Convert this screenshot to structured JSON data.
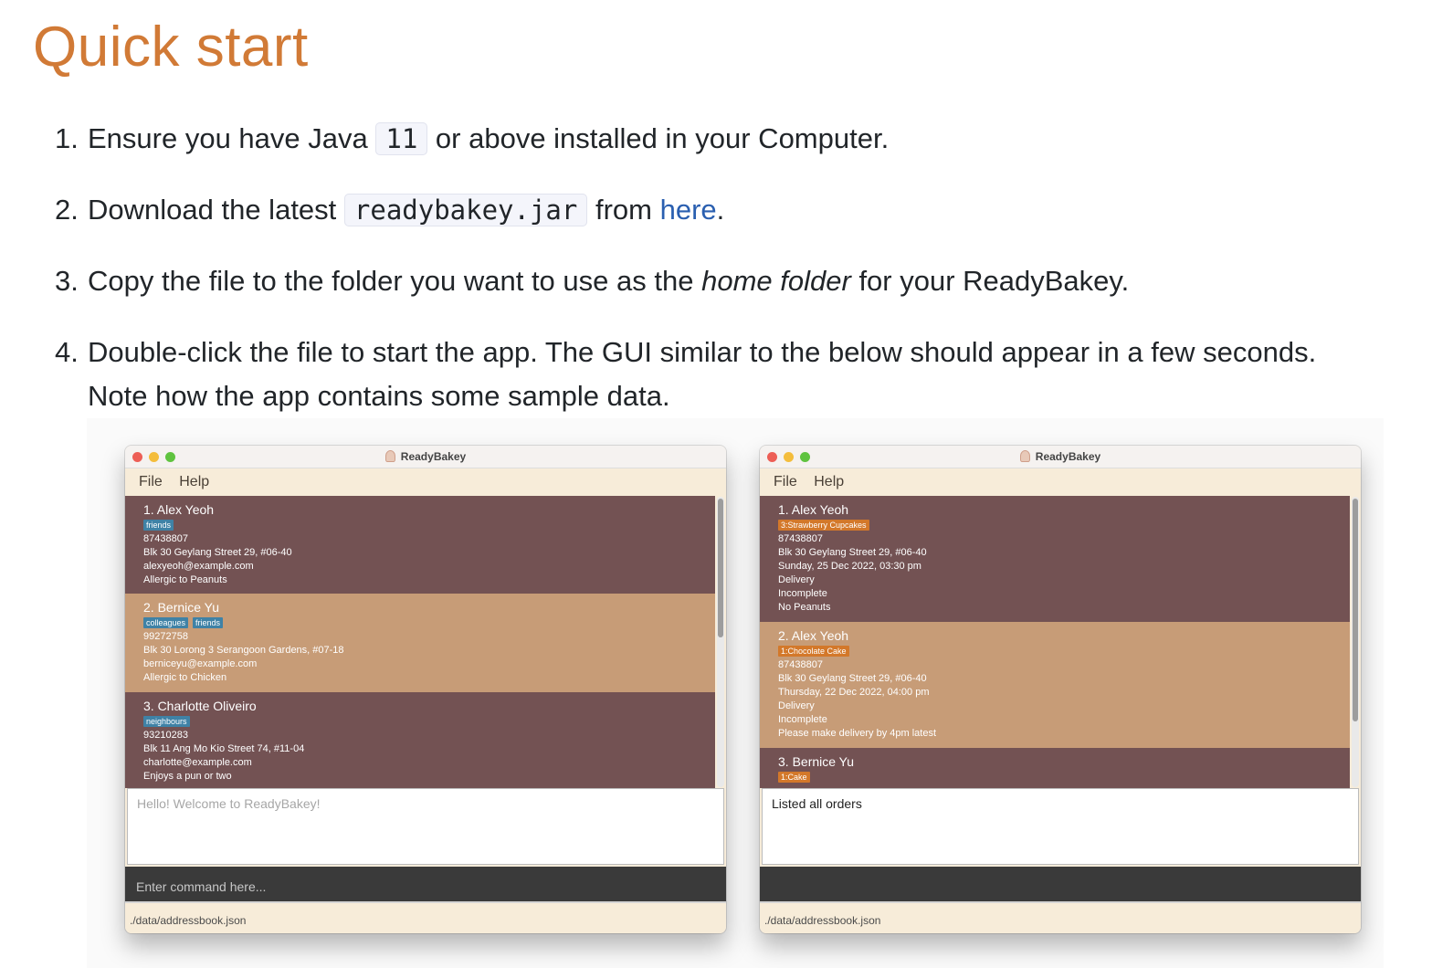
{
  "heading": "Quick start",
  "steps": [
    {
      "num": "1.",
      "pre": "Ensure you have Java",
      "code": "11",
      "post": "or above installed in your Computer."
    },
    {
      "num": "2.",
      "pre": "Download the latest",
      "code": "readybakey.jar",
      "mid": "from",
      "link": "here",
      "post": "."
    },
    {
      "num": "3.",
      "pre": "Copy the file to the folder you want to use as the",
      "em": "home folder",
      "post": "for your ReadyBakey."
    },
    {
      "num": "4.",
      "text": "Double-click the file to start the app. The GUI similar to the below should appear in a few seconds. Note how the app contains some sample data."
    }
  ],
  "windows": [
    {
      "title": "ReadyBakey",
      "menu": [
        "File",
        "Help"
      ],
      "cards": [
        {
          "name": "1.  Alex Yeoh",
          "tags": [
            "friends"
          ],
          "lines": [
            "87438807",
            "Blk 30 Geylang Street 29, #06-40",
            "alexyeoh@example.com",
            "Allergic to Peanuts"
          ]
        },
        {
          "name": "2.  Bernice Yu",
          "tags": [
            "colleagues",
            "friends"
          ],
          "lines": [
            "99272758",
            "Blk 30 Lorong 3 Serangoon Gardens, #07-18",
            "berniceyu@example.com",
            "Allergic to Chicken"
          ]
        },
        {
          "name": "3.  Charlotte Oliveiro",
          "tags": [
            "neighbours"
          ],
          "lines": [
            "93210283",
            "Blk 11 Ang Mo Kio Street 74, #11-04",
            "charlotte@example.com",
            "Enjoys a pun or two"
          ]
        }
      ],
      "result": "Hello! Welcome to ReadyBakey!",
      "command_placeholder": "Enter command here...",
      "status": "./data/addressbook.json"
    },
    {
      "title": "ReadyBakey",
      "menu": [
        "File",
        "Help"
      ],
      "cards": [
        {
          "name": "1.  Alex Yeoh",
          "tags": [
            "3:Strawberry Cupcakes"
          ],
          "lines": [
            "87438807",
            "Blk 30 Geylang Street 29, #06-40",
            "Sunday, 25 Dec 2022, 03:30 pm",
            "Delivery",
            "Incomplete",
            "No Peanuts"
          ]
        },
        {
          "name": "2.  Alex Yeoh",
          "tags": [
            "1:Chocolate Cake"
          ],
          "lines": [
            "87438807",
            "Blk 30 Geylang Street 29, #06-40",
            "Thursday, 22 Dec 2022, 04:00 pm",
            "Delivery",
            "Incomplete",
            "Please make delivery by 4pm latest"
          ]
        },
        {
          "name": "3.  Bernice Yu",
          "tags": [
            "1:Cake"
          ],
          "lines": []
        }
      ],
      "result": "Listed all orders",
      "command_placeholder": "",
      "status": "./data/addressbook.json"
    }
  ],
  "colors": {
    "heading": "#d17a36",
    "card_dark": "#735253",
    "card_light": "#c79c77",
    "tag_blue": "#3f82a6",
    "tag_orange": "#d3782a"
  }
}
